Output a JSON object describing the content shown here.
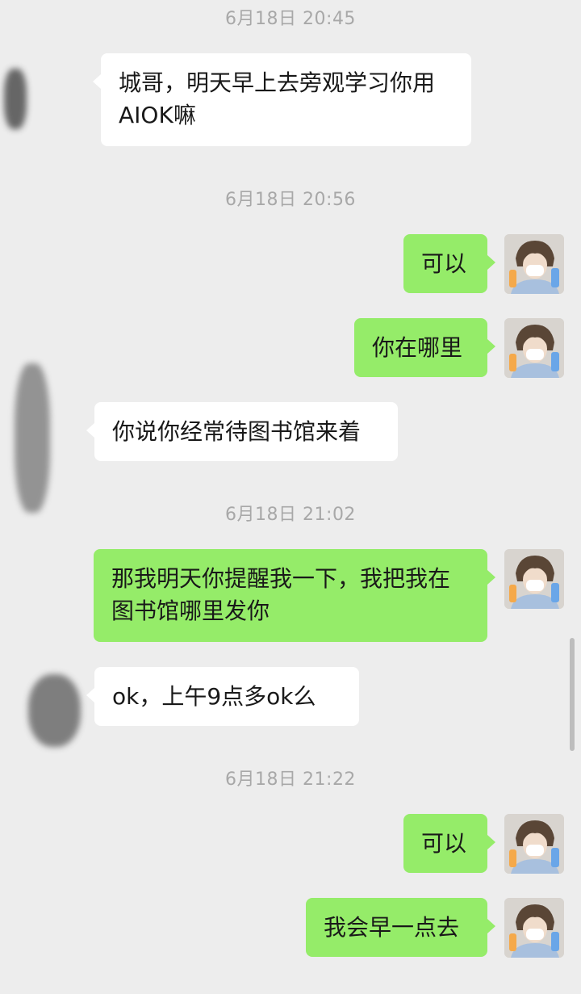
{
  "timestamps": [
    "6月18日 20:45",
    "6月18日 20:56",
    "6月18日 21:02",
    "6月18日 21:22"
  ],
  "messages": [
    {
      "side": "in",
      "text": "城哥，明天早上去旁观学习你用\nAIOK嘛"
    },
    {
      "side": "out",
      "text": "可以"
    },
    {
      "side": "out",
      "text": "你在哪里"
    },
    {
      "side": "in",
      "text": "你说你经常待图书馆来着"
    },
    {
      "side": "out",
      "text": "那我明天你提醒我一下，我把我在\n图书馆哪里发你"
    },
    {
      "side": "in",
      "text": "ok，上午9点多ok么"
    },
    {
      "side": "out",
      "text": "可以"
    },
    {
      "side": "out",
      "text": "我会早一点去"
    }
  ],
  "colors": {
    "background": "#ededed",
    "incoming_bubble": "#ffffff",
    "outgoing_bubble": "#95ec69",
    "timestamp_text": "#a8a8a8"
  }
}
